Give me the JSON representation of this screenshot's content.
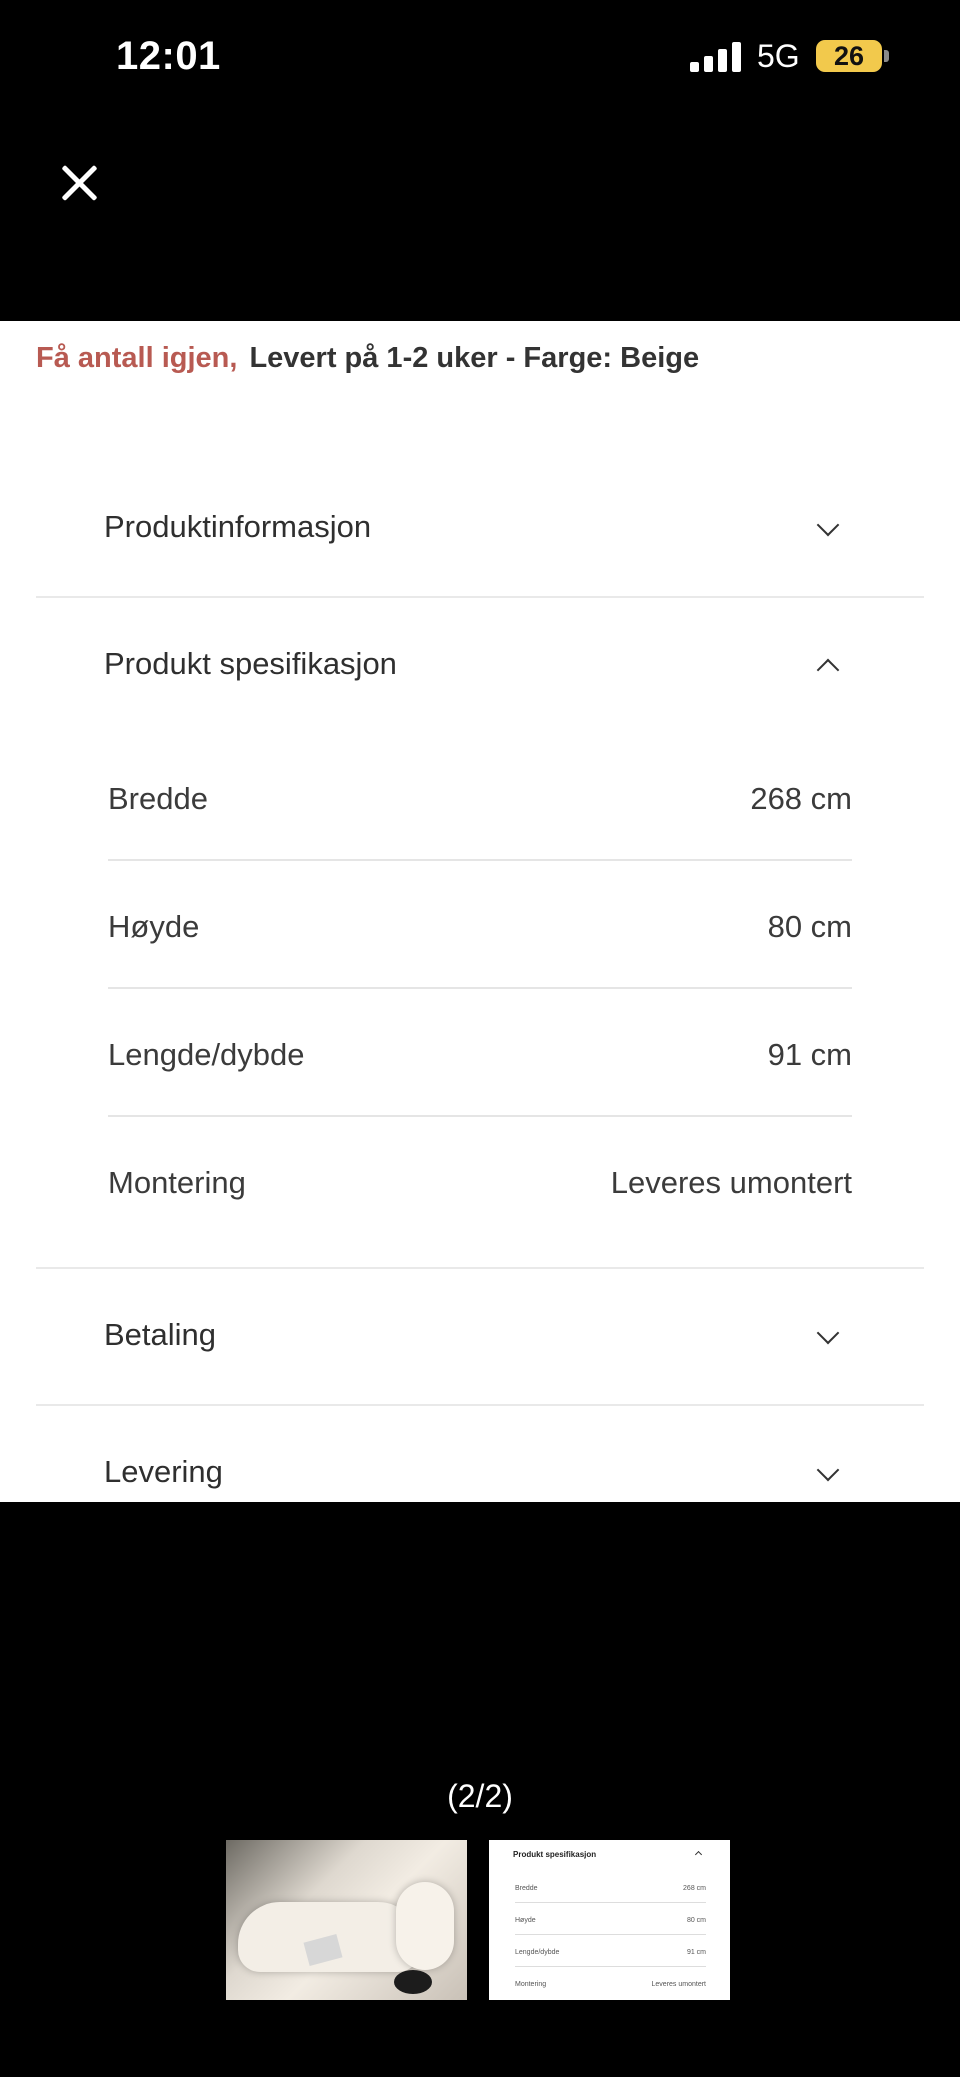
{
  "status_bar": {
    "time": "12:01",
    "network": "5G",
    "battery": "26",
    "icons": [
      "signal-icon",
      "battery-icon"
    ]
  },
  "viewer": {
    "stock_warning": "Få antall igjen,",
    "stock_detail": "Levert på 1-2 uker - Farge: Beige",
    "accordion": [
      {
        "title": "Produktinformasjon",
        "expanded": false
      },
      {
        "title": "Produkt spesifikasjon",
        "expanded": true
      },
      {
        "title": "Betaling",
        "expanded": false
      },
      {
        "title": "Levering",
        "expanded": false
      }
    ],
    "specs": [
      {
        "label": "Bredde",
        "value": "268 cm"
      },
      {
        "label": "Høyde",
        "value": "80 cm"
      },
      {
        "label": "Lengde/dybde",
        "value": "91 cm"
      },
      {
        "label": "Montering",
        "value": "Leveres umontert"
      }
    ]
  },
  "gallery": {
    "counter": "(2/2)",
    "selected_index": 2,
    "thumbnail_preview": {
      "title": "Produkt spesifikasjon",
      "rows": [
        {
          "label": "Bredde",
          "value": "268 cm"
        },
        {
          "label": "Høyde",
          "value": "80 cm"
        },
        {
          "label": "Lengde/dybde",
          "value": "91 cm"
        },
        {
          "label": "Montering",
          "value": "Leveres umontert"
        }
      ]
    }
  },
  "colors": {
    "background": "#000000",
    "panel": "#ffffff",
    "warning": "#b85a52",
    "battery": "#f2c94c"
  }
}
